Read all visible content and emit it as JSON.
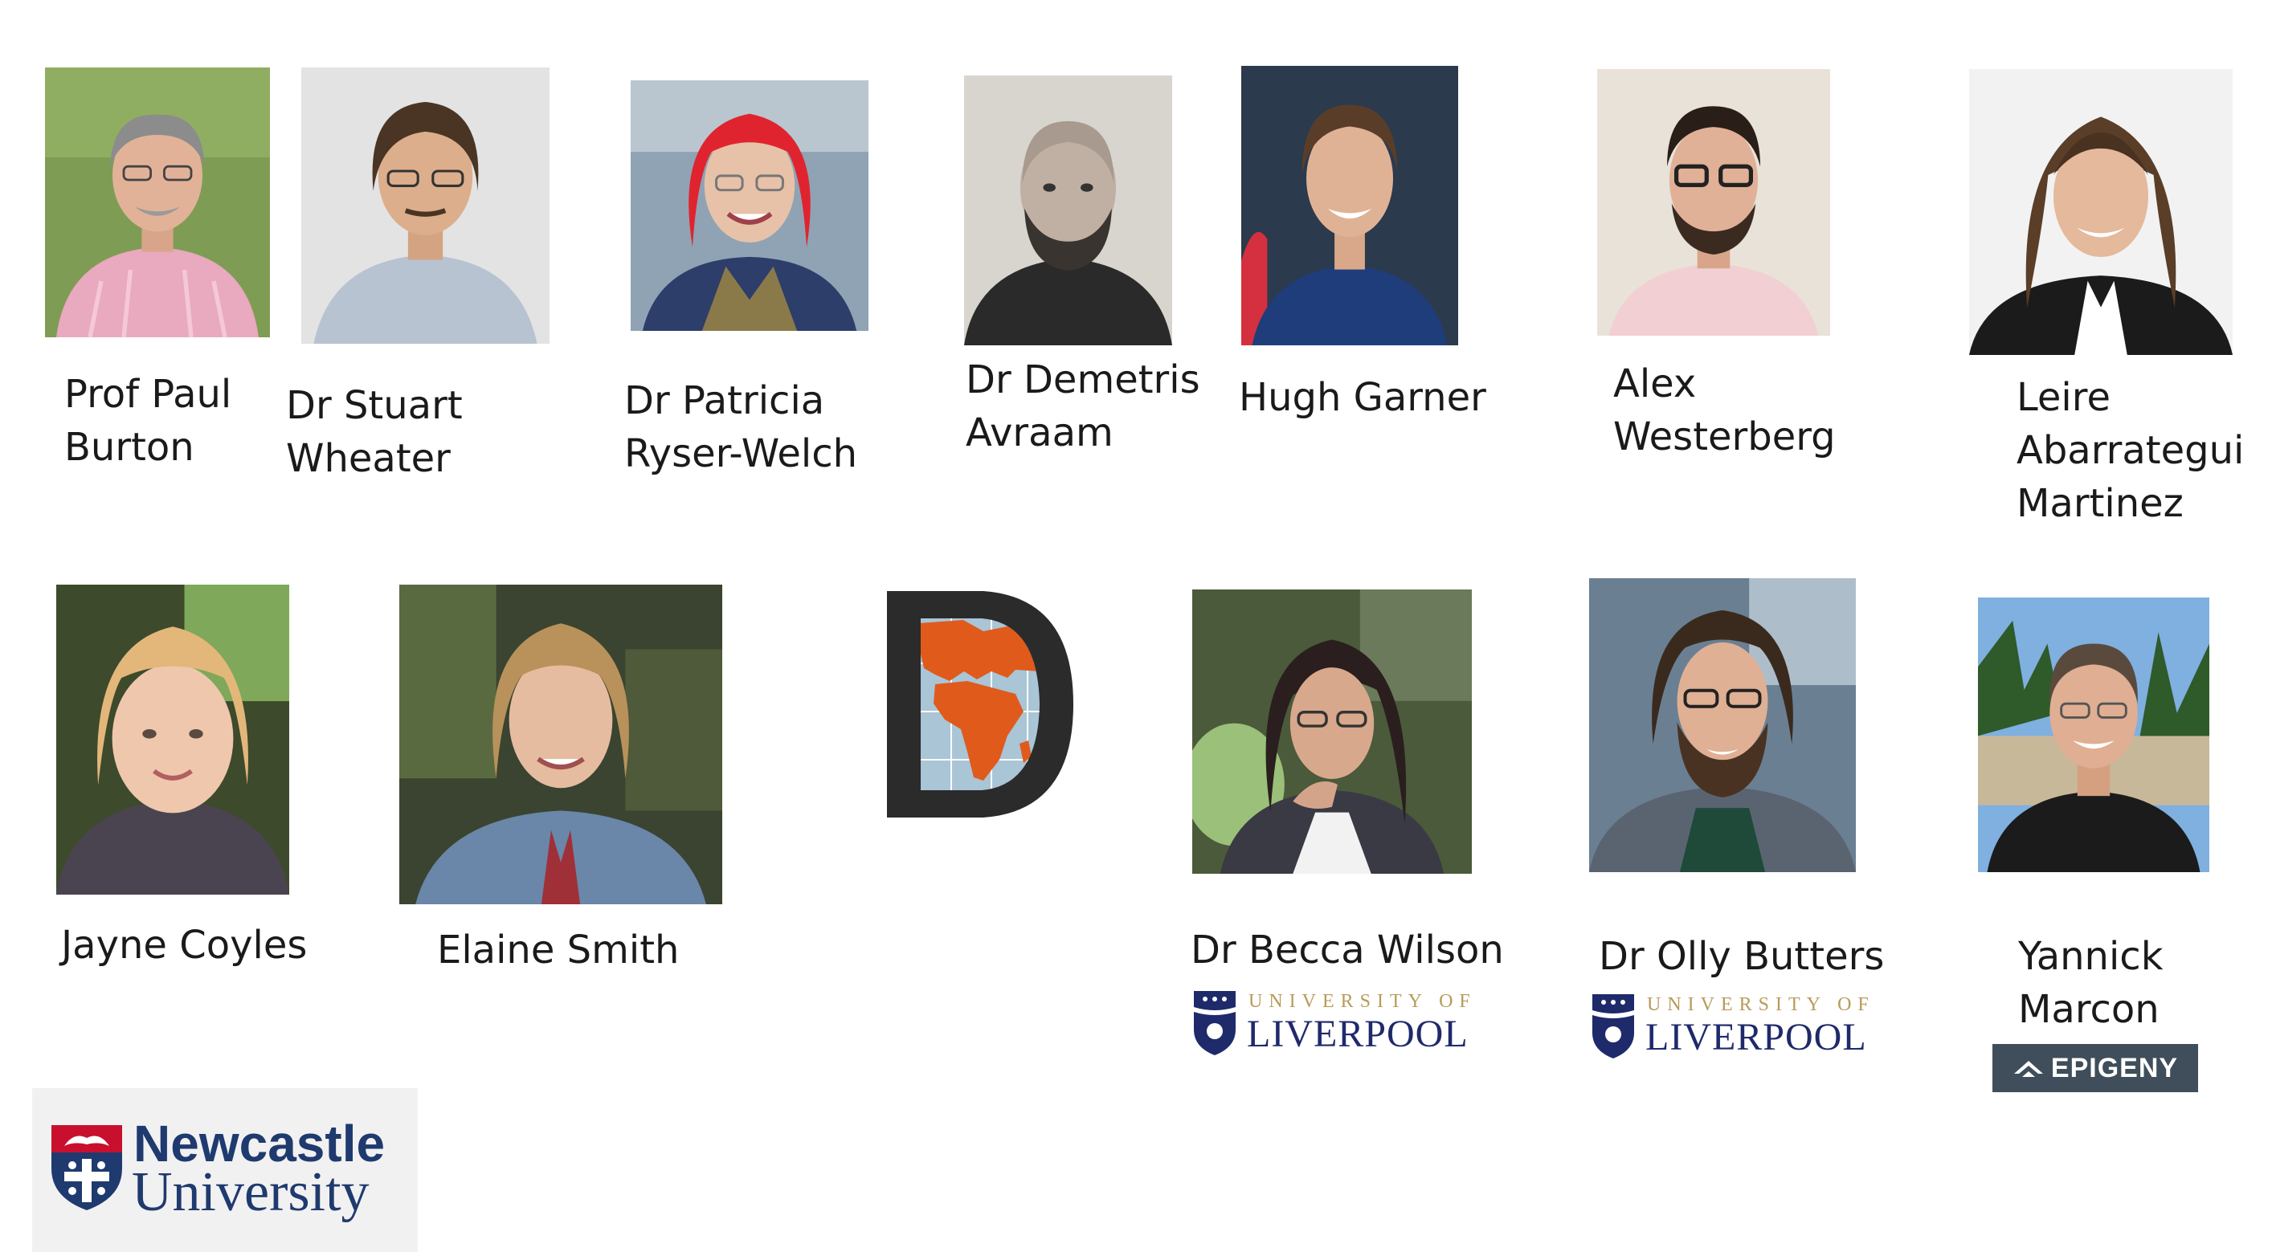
{
  "people": [
    {
      "id": "paul",
      "name_lines": [
        "Prof Paul",
        "Burton"
      ]
    },
    {
      "id": "stuart",
      "name_lines": [
        "Dr Stuart",
        "Wheater"
      ]
    },
    {
      "id": "patricia",
      "name_lines": [
        "Dr Patricia",
        "Ryser-Welch"
      ]
    },
    {
      "id": "demetris",
      "name_lines": [
        "Dr Demetris",
        "Avraam"
      ]
    },
    {
      "id": "hugh",
      "name_lines": [
        "Hugh Garner"
      ]
    },
    {
      "id": "alex",
      "name_lines": [
        "Alex",
        "Westerberg"
      ]
    },
    {
      "id": "leire",
      "name_lines": [
        "Leire",
        "Abarrategui",
        "Martinez"
      ]
    },
    {
      "id": "jayne",
      "name_lines": [
        "Jayne Coyles"
      ]
    },
    {
      "id": "elaine",
      "name_lines": [
        "Elaine Smith"
      ]
    },
    {
      "id": "becca",
      "name_lines": [
        "Dr Becca Wilson"
      ]
    },
    {
      "id": "olly",
      "name_lines": [
        "Dr Olly Butters"
      ]
    },
    {
      "id": "yannick",
      "name_lines": [
        "Yannick",
        "Marcon"
      ]
    }
  ],
  "liverpool_logo": {
    "line1": "UNIVERSITY OF",
    "line2": "LIVERPOOL"
  },
  "epigeny_logo": {
    "text": "EPIGENY"
  },
  "newcastle_logo": {
    "line1": "Newcastle",
    "line2": "University"
  },
  "colors": {
    "liverpool_navy": "#1f2a6b",
    "liverpool_gold": "#b79b58",
    "newcastle_blue": "#1f3a6e",
    "newcastle_red": "#c8102e",
    "epigeny_bg": "#3f4e5a",
    "datashield_orange": "#e05a1c",
    "datashield_sea": "#a9c5d6",
    "datashield_dark": "#2b2b2b"
  }
}
